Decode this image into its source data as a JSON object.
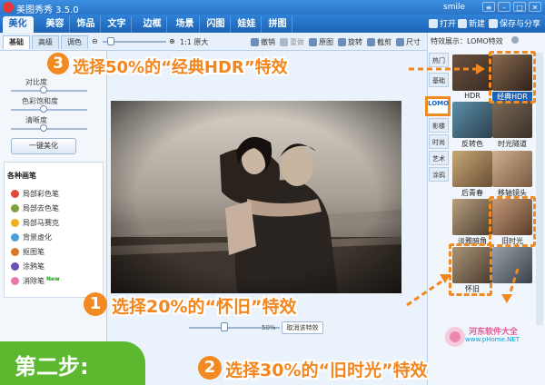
{
  "app": {
    "title": "美图秀秀 3.5.0",
    "user": "smile",
    "window_buttons": [
      "≡",
      "–",
      "□",
      "✕"
    ]
  },
  "navbar": {
    "tabs": [
      "美化",
      "美容",
      "饰品",
      "文字",
      "边框",
      "场景",
      "闪图",
      "娃娃",
      "拼图"
    ],
    "actions": [
      "打开",
      "新建",
      "保存与分享"
    ]
  },
  "toolbar": {
    "subtabs": [
      "基础",
      "高级",
      "调色"
    ],
    "tools": {
      "original_size": "1:1 原大",
      "undo": "撤销",
      "redo": "重做",
      "original": "原图",
      "rotate": "旋转",
      "crop": "截剪",
      "size": "尺寸"
    }
  },
  "left_panel": {
    "sliders": [
      "对比度",
      "色彩饱和度",
      "清晰度"
    ],
    "one_click_button": "一键美化",
    "pens_title": "各种画笔",
    "pens": [
      {
        "label": "局部彩色笔",
        "color": "#e3463c",
        "new": false
      },
      {
        "label": "局部去色笔",
        "color": "#7aa13f",
        "new": false
      },
      {
        "label": "局部马赛克",
        "color": "#f2b01e",
        "new": false
      },
      {
        "label": "背景虚化",
        "color": "#4aa0d8",
        "new": false
      },
      {
        "label": "抠图笔",
        "color": "#d87a2e",
        "new": false
      },
      {
        "label": "涂鸦笔",
        "color": "#6c4fb8",
        "new": false
      },
      {
        "label": "消除笔",
        "color": "#e57aa8",
        "new": true
      }
    ],
    "new_badge": "New"
  },
  "canvas": {
    "effect_opacity_value": "50%",
    "effect_opacity_fraction": 0.5,
    "cancel_effect": "取消该特效"
  },
  "right_panel": {
    "header": "特效展示：LOMO特效",
    "categories": [
      {
        "label": "热门",
        "active": false
      },
      {
        "label": "基础",
        "active": false
      },
      {
        "label": "LOMO",
        "active": true
      },
      {
        "label": "影楼",
        "active": false
      },
      {
        "label": "时尚",
        "active": false
      },
      {
        "label": "艺术",
        "active": false
      },
      {
        "label": "涂鸦",
        "active": false
      }
    ],
    "effects": [
      {
        "label": "HDR",
        "selected": false
      },
      {
        "label": "经典HDR",
        "selected": true
      },
      {
        "label": "反转色",
        "selected": false
      },
      {
        "label": "时光隧道",
        "selected": false
      },
      {
        "label": "后青春",
        "selected": false
      },
      {
        "label": "移轴镜头",
        "selected": false
      },
      {
        "label": "淡雅暗角",
        "selected": false
      },
      {
        "label": "旧时光",
        "selected": false
      },
      {
        "label": "怀旧",
        "selected": false
      },
      {
        "label": "",
        "selected": false
      }
    ]
  },
  "annotations": {
    "step1": {
      "number": "1",
      "text": "选择20%的“怀旧”特效"
    },
    "step2": {
      "number": "2",
      "text": "选择30%的“旧时光”特效"
    },
    "step3": {
      "number": "3",
      "text": "选择50%的“经典HDR”特效"
    }
  },
  "step_badge": "第二步:",
  "watermark": {
    "text": "河东软件大全",
    "url": "www.pHome.NET"
  },
  "colors": {
    "accent_orange": "#f2861f",
    "brand_blue": "#1d63b6",
    "step_green": "#5db830"
  }
}
